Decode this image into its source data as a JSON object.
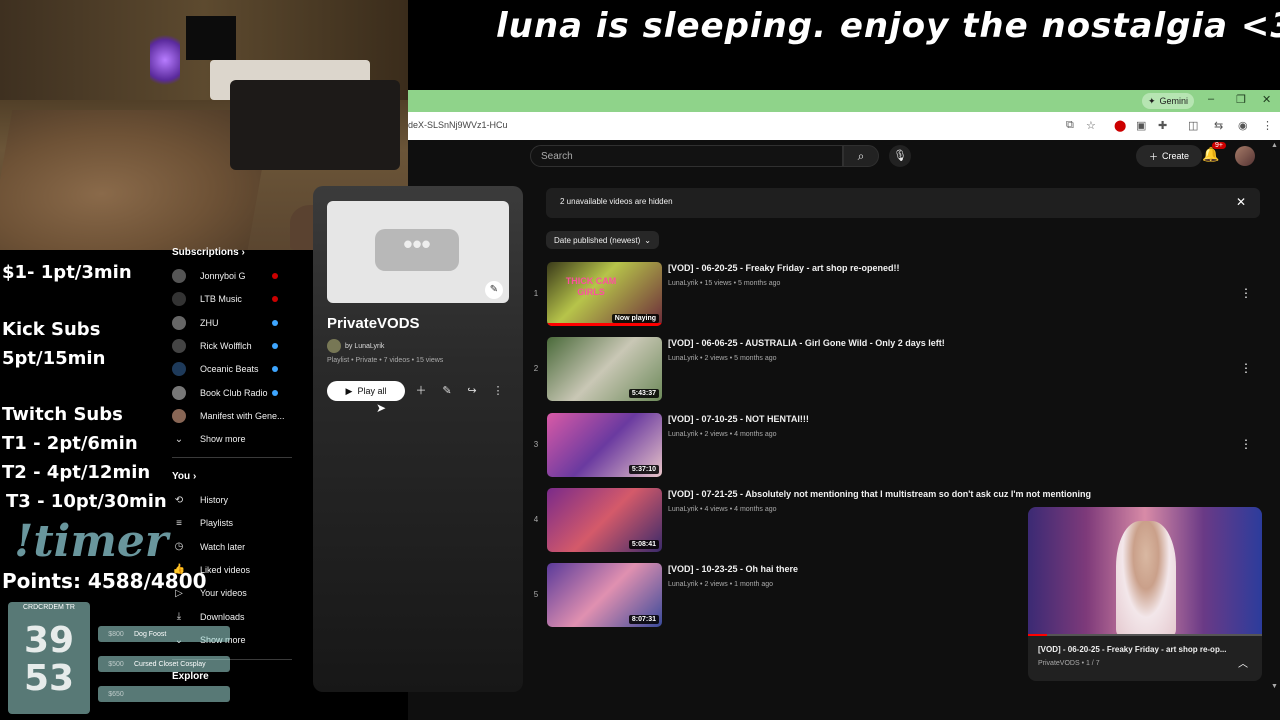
{
  "overlay": {
    "title": "luna is sleeping. enjoy the nostalgia <3",
    "rates": {
      "donation": "$1- 1pt/3min",
      "kick_head": "Kick Subs",
      "kick_rate": "5pt/15min",
      "twitch_head": "Twitch Subs",
      "t1": "T1 - 2pt/6min",
      "t2": "T2 - 4pt/12min",
      "t3": "T3 - 10pt/30min"
    },
    "timer_cmd": "!timer",
    "points": "Points:  4588/4800",
    "countdown": {
      "label": "CRDCRDEM TR",
      "hours": "39",
      "minutes": "53"
    },
    "goals": [
      {
        "amount": "$800",
        "name": "Dog Foost"
      },
      {
        "amount": "$500",
        "name": "Cursed Closet Cosplay"
      },
      {
        "amount": "$650",
        "name": ""
      }
    ]
  },
  "browser": {
    "gemini_label": "Gemini",
    "window_controls": {
      "minimize": "–",
      "restore": "❐",
      "close": "✕"
    },
    "url": "deX-SLSnNj9WVz1-HCu"
  },
  "youtube": {
    "search_placeholder": "Search",
    "create_label": "Create",
    "notif_count": "9+",
    "sidebar": {
      "subscriptions_head": "Subscriptions",
      "subscriptions": [
        {
          "name": "Jonnyboi G",
          "color": "#555555",
          "dot": "#cc0000"
        },
        {
          "name": "LTB Music",
          "color": "#333333",
          "dot": "#cc0000"
        },
        {
          "name": "ZHU",
          "color": "#666666",
          "dot": "#3ea6ff"
        },
        {
          "name": "Rick Wolfflch",
          "color": "#444444",
          "dot": "#3ea6ff"
        },
        {
          "name": "Oceanic Beats",
          "color": "#1e3a5a",
          "dot": "#3ea6ff"
        },
        {
          "name": "Book Club Radio",
          "color": "#777777",
          "dot": "#3ea6ff"
        },
        {
          "name": "Manifest with Gene...",
          "color": "#886655",
          "dot": ""
        }
      ],
      "show_more_1": "Show more",
      "you_head": "You",
      "you_items": [
        {
          "label": "History",
          "icon": "history-icon"
        },
        {
          "label": "Playlists",
          "icon": "playlists-icon"
        },
        {
          "label": "Watch later",
          "icon": "watch-later-icon"
        },
        {
          "label": "Liked videos",
          "icon": "liked-icon"
        },
        {
          "label": "Your videos",
          "icon": "your-videos-icon"
        },
        {
          "label": "Downloads",
          "icon": "downloads-icon"
        }
      ],
      "show_more_2": "Show more",
      "explore_head": "Explore"
    },
    "playlist": {
      "title": "PrivateVODS",
      "owner": "by LunaLyrik",
      "meta": "Playlist • Private • 7 videos • 15 views",
      "play_all": "Play all"
    },
    "hidden_notice": "2 unavailable videos are hidden",
    "sort_label": "Date published (newest)",
    "videos": [
      {
        "index": "1",
        "title": "[VOD] - 06-20-25 - Freaky Friday - art shop re-opened!!",
        "channel": "LunaLyrik",
        "stats": "15 views • 5 months ago",
        "badge": "Now playing",
        "thumb_text": "THICK CAM GIRLS"
      },
      {
        "index": "2",
        "title": "[VOD] - 06-06-25 - AUSTRALIA - Girl Gone Wild - Only 2 days left!",
        "channel": "LunaLyrik",
        "stats": "2 views • 5 months ago",
        "badge": "5:43:37"
      },
      {
        "index": "3",
        "title": "[VOD] - 07-10-25 - NOT HENTAI!!!",
        "channel": "LunaLyrik",
        "stats": "2 views • 4 months ago",
        "badge": "5:37:10"
      },
      {
        "index": "4",
        "title": "[VOD] - 07-21-25 - Absolutely not mentioning that I multistream so don't ask cuz I'm not mentioning",
        "channel": "LunaLyrik",
        "stats": "4 views • 4 months ago",
        "badge": "5:08:41"
      },
      {
        "index": "5",
        "title": "[VOD] - 10-23-25 - Oh hai there",
        "channel": "LunaLyrik",
        "stats": "2 views • 1 month ago",
        "badge": "8:07:31"
      }
    ],
    "mini_player": {
      "title": "[VOD] - 06-20-25 - Freaky Friday - art shop re-op...",
      "sub": "PrivateVODS • 1 / 7",
      "progress": 0.08
    }
  }
}
